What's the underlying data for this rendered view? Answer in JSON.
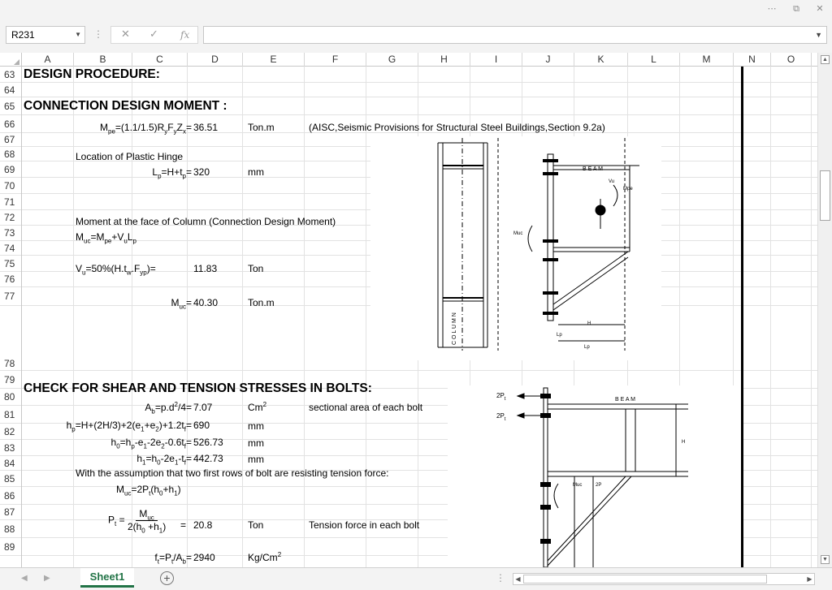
{
  "window": {
    "ribbon_options": "⋯",
    "restore": "⧉",
    "close": "✕"
  },
  "formula_bar": {
    "name_box": "R231",
    "cancel": "✕",
    "enter": "✓",
    "function": "fx",
    "content": ""
  },
  "columns": [
    "A",
    "B",
    "C",
    "D",
    "E",
    "F",
    "G",
    "H",
    "I",
    "J",
    "K",
    "L",
    "M",
    "N",
    "O"
  ],
  "rows": [
    "63",
    "64",
    "65",
    "66",
    "67",
    "68",
    "69",
    "70",
    "71",
    "72",
    "73",
    "74",
    "75",
    "76",
    "77",
    "78",
    "79",
    "80",
    "81",
    "82",
    "83",
    "84",
    "85",
    "86",
    "87",
    "88",
    "89"
  ],
  "sheet": {
    "r63_a": "DESIGN PROCEDURE:",
    "r65_a": "CONNECTION  DESIGN  MOMENT :",
    "r66_f_mpe": "M",
    "r66_s_mpe": "pe",
    "r66_t1": "=(1.1/1.5)R",
    "r66_s_y1": "y",
    "r66_t2": "F",
    "r66_s_y2": "y",
    "r66_t3": "Z",
    "r66_s_x": "x",
    "r66_t4": "=",
    "r66_d": "36.51",
    "r66_e": "Ton.m",
    "r66_f": "(AISC,Seismic Provisions for Structural Steel Buildings,Section 9.2a)",
    "r68_b": "Location of Plastic Hinge",
    "r69_t1": "L",
    "r69_s1": "p",
    "r69_t2": "=H+t",
    "r69_s2": "p",
    "r69_t3": "=",
    "r69_d": "320",
    "r69_e": "mm",
    "r72_b": "Moment at the face of Column (Connection Design Moment)",
    "r73_t1": "M",
    "r73_s1": "uc",
    "r73_t2": "=M",
    "r73_s2": "pe",
    "r73_t3": "+V",
    "r73_s3": "u",
    "r73_t4": "L",
    "r73_s4": "p",
    "r75_t1": "V",
    "r75_s1": "u",
    "r75_t2": "=50%(H.t",
    "r75_s2": "w",
    "r75_t3": ".F",
    "r75_s3": "yp",
    "r75_t4": ")=",
    "r75_d": "11.83",
    "r75_e": "Ton",
    "r77_t1": "M",
    "r77_s1": "uc",
    "r77_t2": "=",
    "r77_d": "40.30",
    "r77_e": "Ton.m",
    "r79_a": "CHECK  FOR  SHEAR  AND  TENSION  STRESSES  IN  BOLTS:",
    "r80_t1": "A",
    "r80_s1": "b",
    "r80_t2": "=p.d",
    "r80_p1": "2",
    "r80_t3": "/4=",
    "r80_d": "7.07",
    "r80_e": "Cm",
    "r80_ep": "2",
    "r80_f": "sectional area of each bolt",
    "r81_t1": "h",
    "r81_s1": "p",
    "r81_t2": "=H+(2H/3)+2(e",
    "r81_s2": "1",
    "r81_t3": "+e",
    "r81_s3": "2",
    "r81_t4": ")+1.2t",
    "r81_s4": "f",
    "r81_t5": "=",
    "r81_d": "690",
    "r81_e": "mm",
    "r82_t1": "h",
    "r82_s1": "0",
    "r82_t2": "=h",
    "r82_s2": "p",
    "r82_t3": "-e",
    "r82_s3": "1",
    "r82_t4": "-2e",
    "r82_s4": "2",
    "r82_t5": "-0.6t",
    "r82_s5": "f",
    "r82_t6": "=",
    "r82_d": "526.73",
    "r82_e": "mm",
    "r83_t1": "h",
    "r83_s1": "1",
    "r83_t2": "=h",
    "r83_s2": "0",
    "r83_t3": "-2e",
    "r83_s3": "1",
    "r83_t4": "-t",
    "r83_s4": "f",
    "r83_t5": "=",
    "r83_d": "442.73",
    "r83_e": "mm",
    "r84_b": "With the assumption that two first rows of bolt are resisting tension force:",
    "r85_t1": "M",
    "r85_s1": "uc",
    "r85_t2": "=2P",
    "r85_s2": "t",
    "r85_t3": "(h",
    "r85_s3": "0",
    "r85_t4": "+h",
    "r85_s4": "1",
    "r85_t5": ")",
    "r87_pt": "P",
    "r87_pts": "t",
    "r87_eq1": "=",
    "r87_num": "M",
    "r87_nums": "uc",
    "r87_den1": "2(h",
    "r87_dens1": "0",
    "r87_den2": " +h",
    "r87_dens2": "1",
    "r87_den3": ")",
    "r87_eq2": "=",
    "r87_d": "20.8",
    "r87_e": "Ton",
    "r87_f": "Tension force in each bolt",
    "r89_t1": "f",
    "r89_s1": "t",
    "r89_t2": "=P",
    "r89_s2": "t",
    "r89_t3": "/A",
    "r89_s3": "b",
    "r89_t4": "=",
    "r89_d": "2940",
    "r89_e": "Kg/Cm",
    "r89_ep": "2"
  },
  "drawing1": {
    "beam": "B E A M",
    "column": "C O L U M N",
    "vu": "Vu",
    "mpe": "Mpe",
    "muc": "Muc",
    "h": "H",
    "lp_small": "Lp",
    "h_dim": "H",
    "lp": "Lp"
  },
  "drawing2": {
    "p1": "2P",
    "p1s": "t",
    "p2": "2P",
    "p2s": "t",
    "beam": "B E A M",
    "h": "H",
    "muc": "Muc",
    "p3": "2P"
  },
  "tabs": {
    "sheet1": "Sheet1",
    "add": "+"
  },
  "nav": {
    "prev": "◀",
    "next": "▶"
  },
  "hscroll": {
    "dots": "⋮",
    "left": "◀",
    "right": "▶"
  },
  "vscroll": {
    "up": "▲",
    "down": "▼"
  }
}
